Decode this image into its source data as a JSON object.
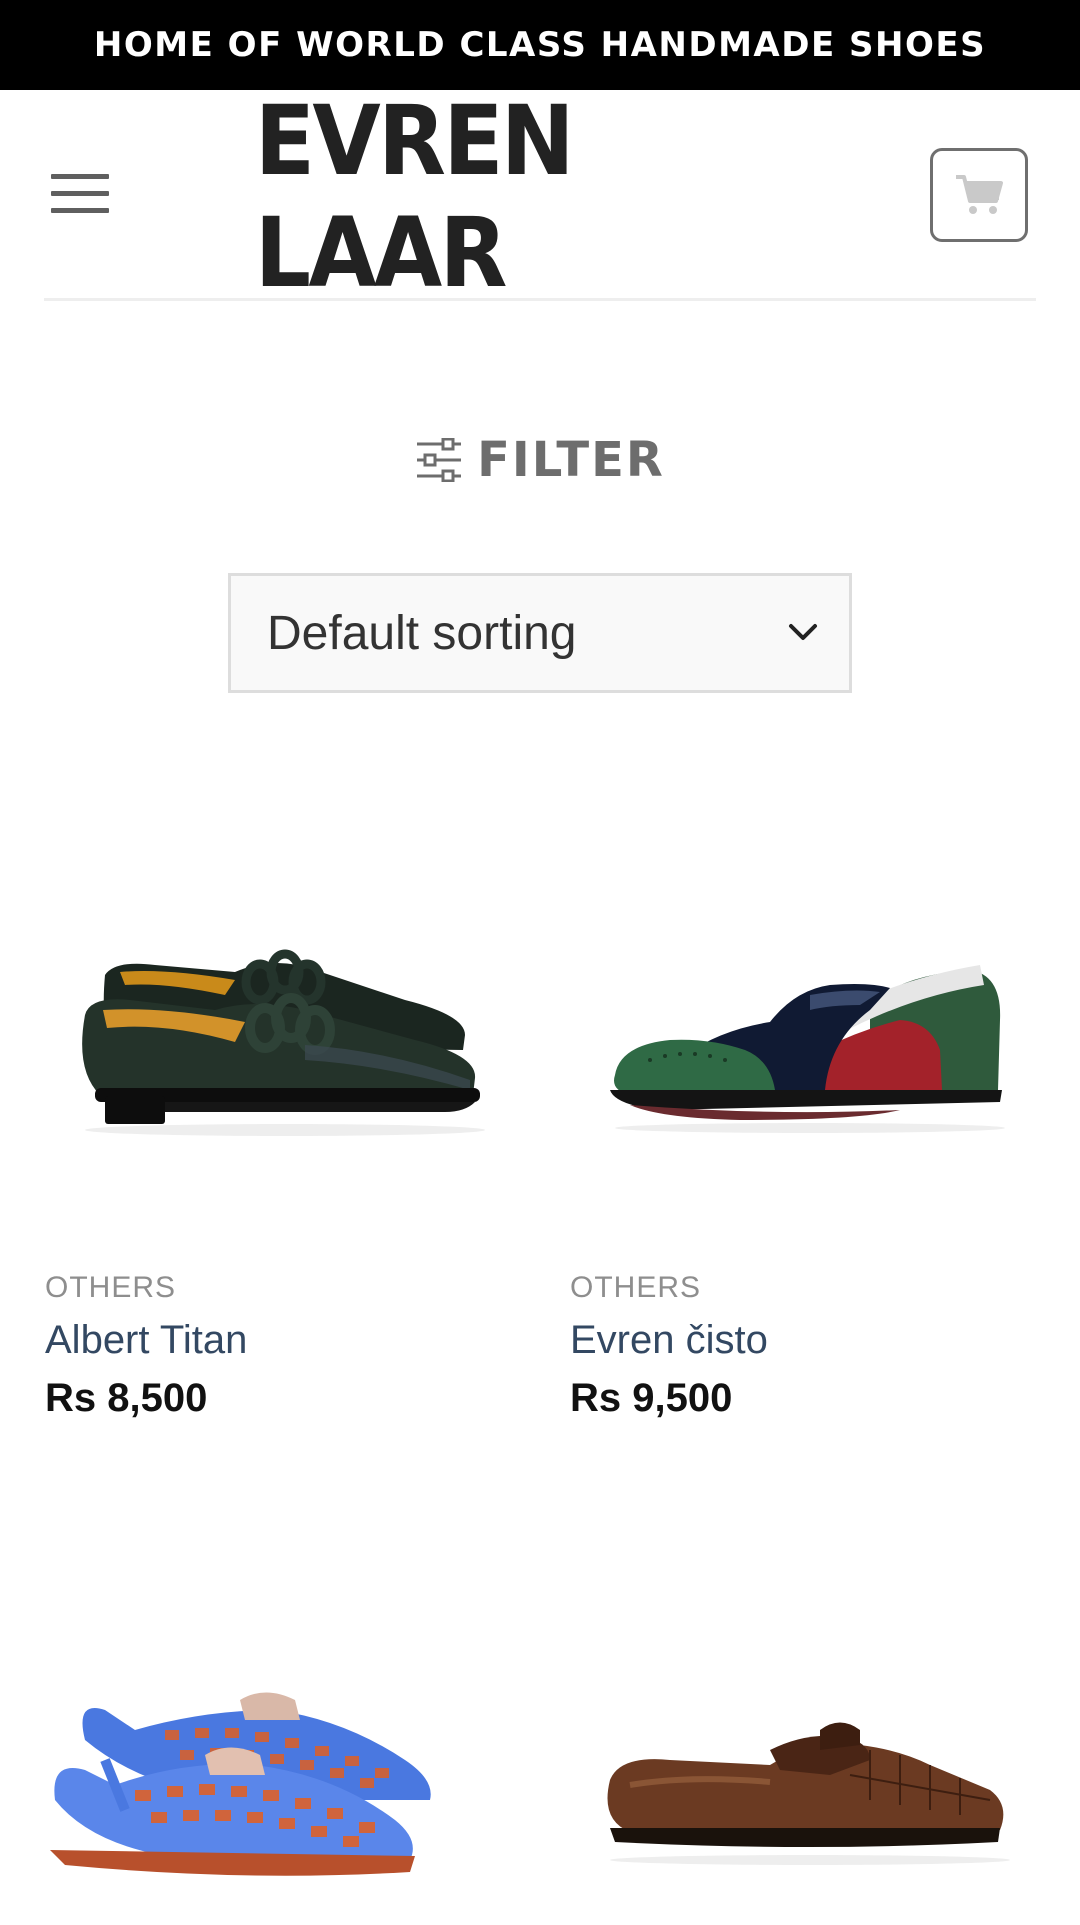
{
  "topbar": {
    "text": "HOME OF WORLD CLASS HANDMADE SHOES"
  },
  "header": {
    "logo_text": "EVREN LAAR",
    "menu_icon": "hamburger-menu-icon",
    "cart_icon": "shopping-cart-icon"
  },
  "filter": {
    "label": "FILTER",
    "icon": "sliders-icon"
  },
  "sort": {
    "selected": "Default sorting",
    "icon": "chevron-down-icon"
  },
  "products": [
    {
      "category": "OTHERS",
      "name": "Albert Titan",
      "price": "Rs 8,500"
    },
    {
      "category": "OTHERS",
      "name": "Evren čisto",
      "price": "Rs 9,500"
    },
    {
      "category": "",
      "name": "",
      "price": ""
    },
    {
      "category": "",
      "name": "",
      "price": ""
    }
  ],
  "colors": {
    "topbar_bg": "#000000",
    "link": "#334862",
    "muted": "#8e8e8e"
  }
}
